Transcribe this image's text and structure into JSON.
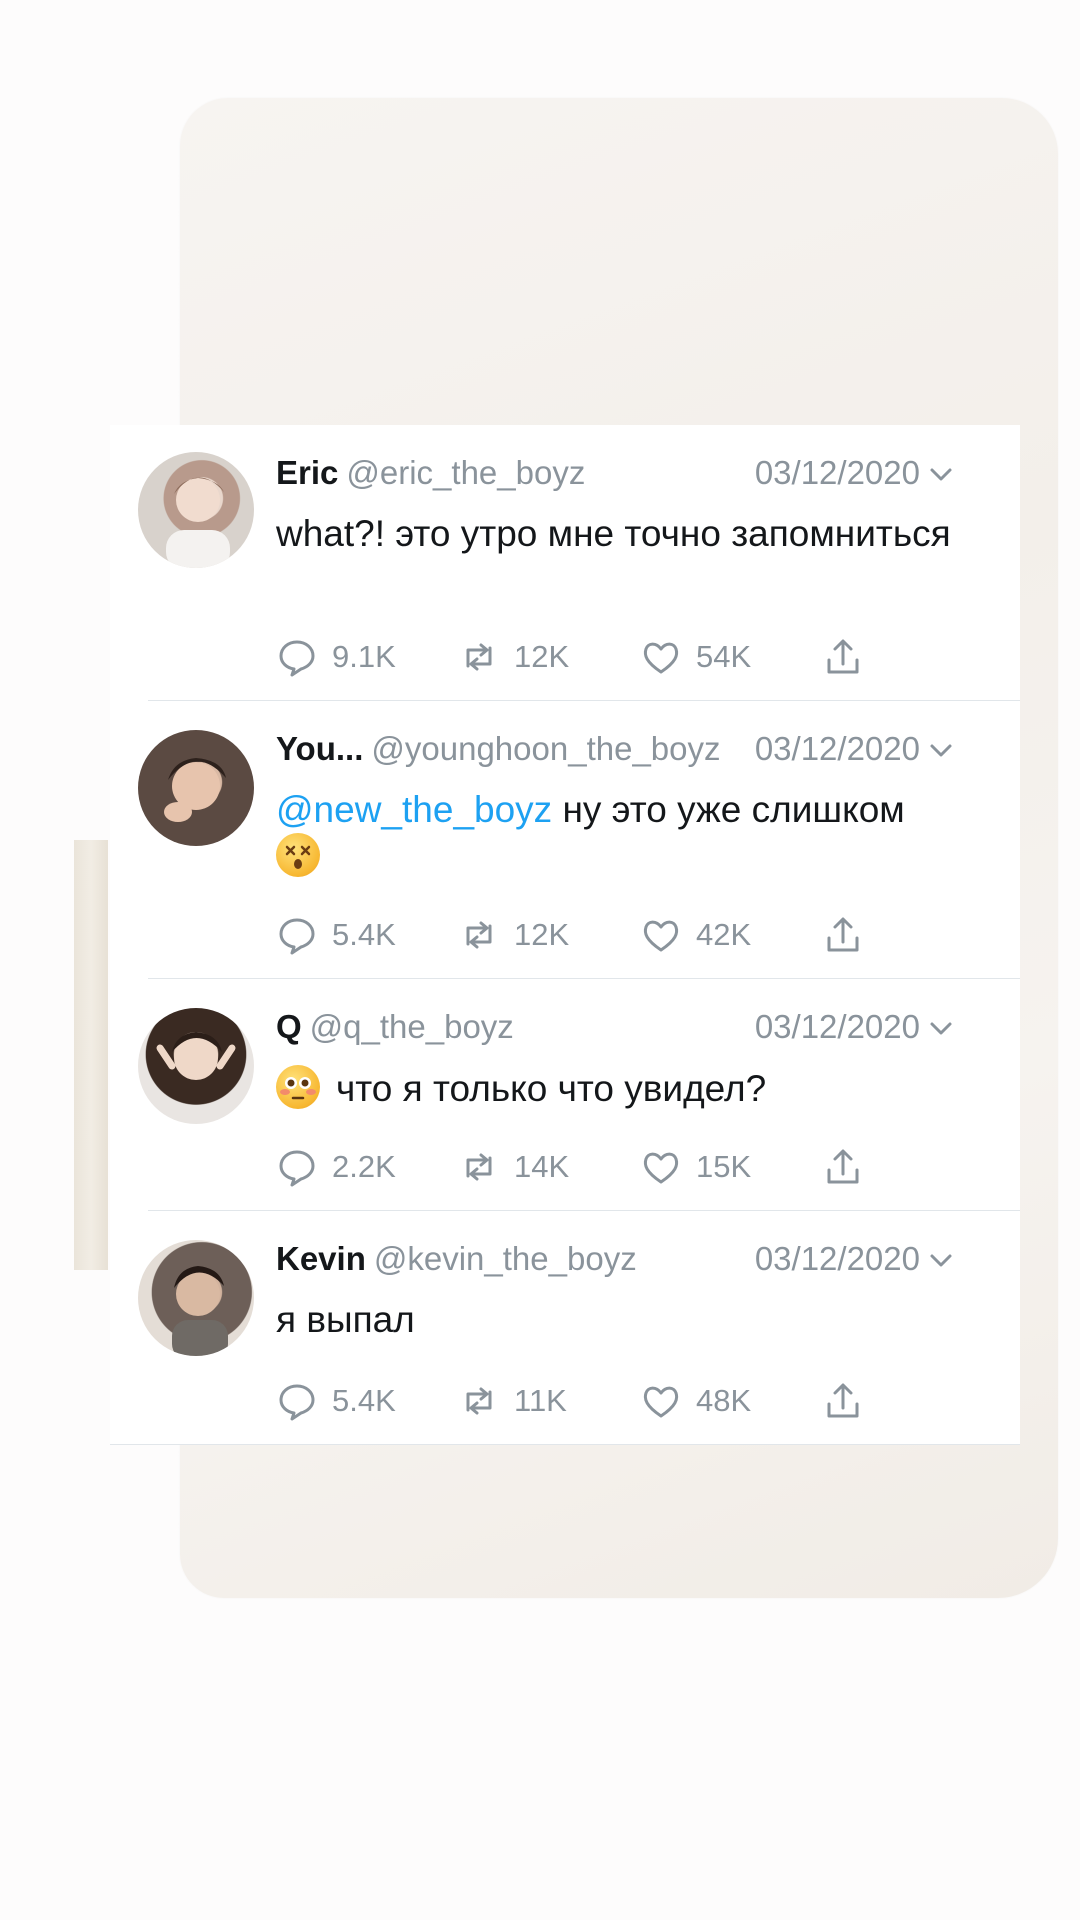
{
  "tweets": [
    {
      "name": "Eric",
      "handle": "@eric_the_boyz",
      "date": "03/12/2020",
      "mention": "",
      "text": "what?! это утро мне точно запомниться",
      "emoji_before": "",
      "emoji_after": "",
      "replies": "9.1K",
      "retweets": "12K",
      "likes": "54K"
    },
    {
      "name": "You...",
      "handle": "@younghoon_the_boyz",
      "date": "03/12/2020",
      "mention": "@new_the_boyz",
      "text": " ну это уже слишком",
      "emoji_before": "",
      "emoji_after": "dizzy-face-emoji",
      "replies": "5.4K",
      "retweets": "12K",
      "likes": "42K"
    },
    {
      "name": "Q",
      "handle": "@q_the_boyz",
      "date": "03/12/2020",
      "mention": "",
      "text": "что я только что увидел?",
      "emoji_before": "flushed-face-emoji",
      "emoji_after": "",
      "replies": "2.2K",
      "retweets": "14K",
      "likes": "15K"
    },
    {
      "name": "Kevin",
      "handle": "@kevin_the_boyz",
      "date": "03/12/2020",
      "mention": "",
      "text": "я выпал",
      "emoji_before": "",
      "emoji_after": "",
      "replies": "5.4K",
      "retweets": "11K",
      "likes": "48K"
    }
  ],
  "colors": {
    "mention": "#1da1f2",
    "text": "#14171a",
    "muted": "#8a939b",
    "background": "#fdfcfc",
    "paper": "#f5f1ec"
  }
}
